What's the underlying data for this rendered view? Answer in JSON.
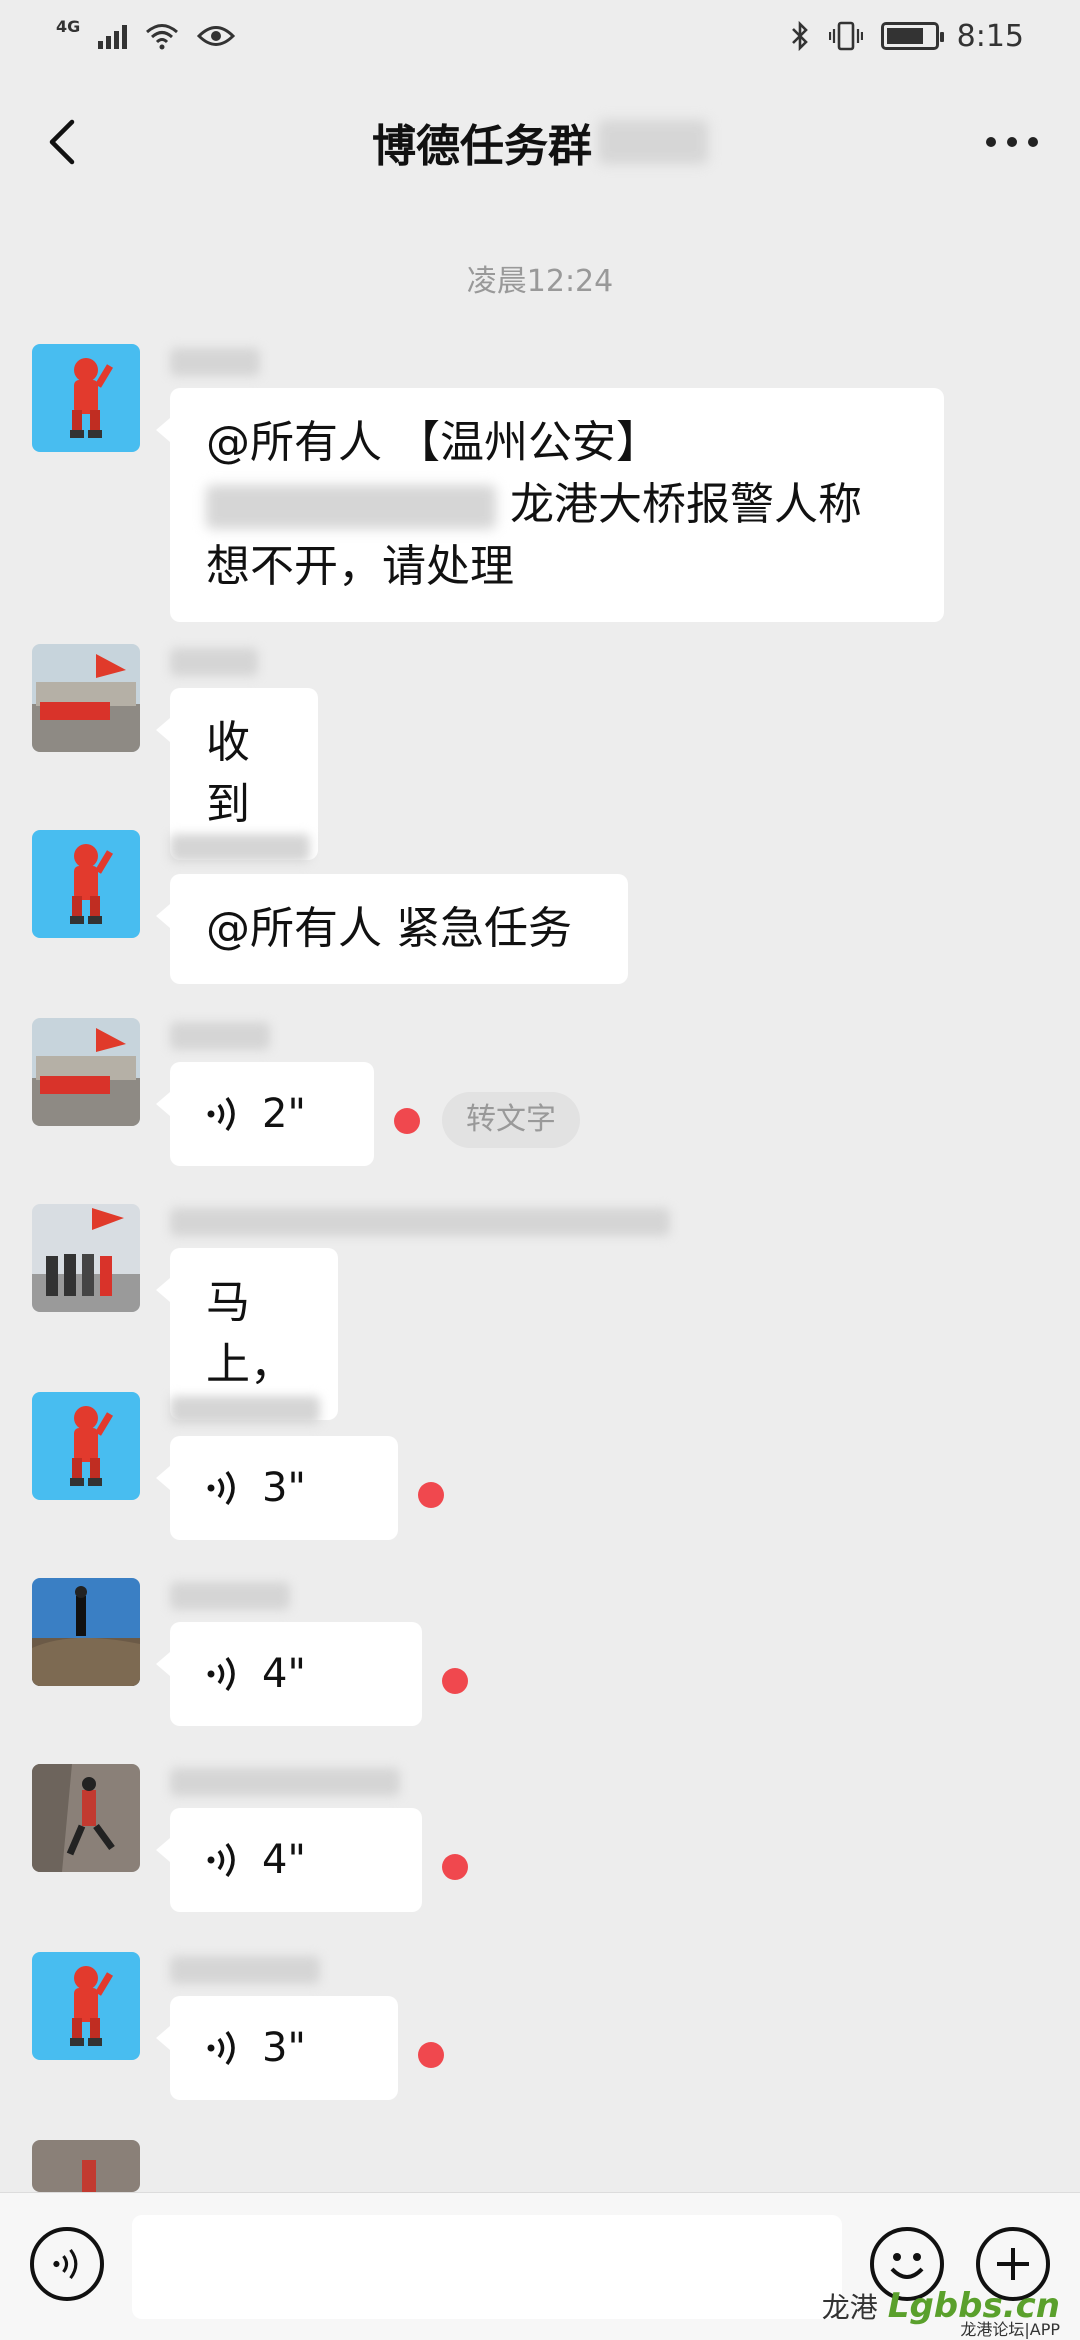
{
  "status_bar": {
    "network": "4G",
    "time": "8:15"
  },
  "header": {
    "title": "博德任务群"
  },
  "timestamp": "凌晨12:24",
  "messages": [
    {
      "type": "text",
      "line1": "@所有人 【温州公安】",
      "line2": "龙港大桥报警人称",
      "line3": "想不开，请处理"
    },
    {
      "type": "text",
      "text": "收到"
    },
    {
      "type": "text",
      "text": "@所有人 紧急任务"
    },
    {
      "type": "voice",
      "duration": "2\"",
      "convert_label": "转文字"
    },
    {
      "type": "text",
      "text": "马上，"
    },
    {
      "type": "voice",
      "duration": "3\""
    },
    {
      "type": "voice",
      "duration": "4\""
    },
    {
      "type": "voice",
      "duration": "4\""
    },
    {
      "type": "voice",
      "duration": "3\""
    }
  ],
  "watermark": {
    "text": "龙港",
    "logo": "Lgbbs.cn",
    "sub": "龙港论坛|APP"
  },
  "colors": {
    "background": "#ededed",
    "bubble": "#ffffff",
    "unread_dot": "#f0484e"
  }
}
